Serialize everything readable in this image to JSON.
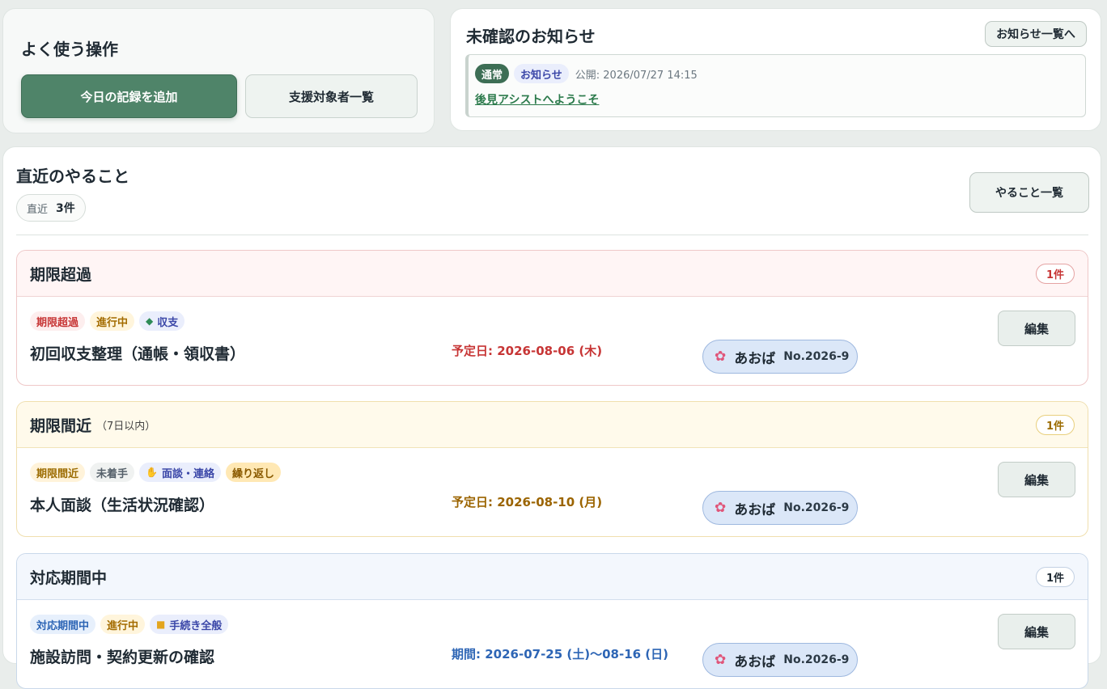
{
  "quick": {
    "title": "よく使う操作",
    "add_today": "今日の記録を追加",
    "clients": "支援対象者一覧"
  },
  "notice": {
    "title": "未確認のお知らせ",
    "all_button": "お知らせ一覧へ",
    "item": {
      "badge_type": "通常",
      "badge_kind": "お知らせ",
      "published": "公開: 2026/07/27 14:15",
      "link": "後見アシストへようこそ"
    }
  },
  "todo": {
    "title": "直近のやること",
    "count_label": "直近",
    "count_value": "3件",
    "all_button": "やること一覧",
    "groups": [
      {
        "title": "期限超過",
        "subtitle": "",
        "count": "1件",
        "task": {
          "tags": [
            "期限超過",
            "進行中",
            "収支"
          ],
          "category_icon": "money-icon",
          "title": "初回収支整理（通帳・領収書）",
          "due": "予定日: 2026-08-06 (木)",
          "person_name": "あおば",
          "person_no": "No.2026-9",
          "edit": "編集"
        }
      },
      {
        "title": "期限間近",
        "subtitle": "（7日以内）",
        "count": "1件",
        "task": {
          "tags": [
            "期限間近",
            "未着手",
            "面談・連絡",
            "繰り返し"
          ],
          "category_icon": "handshake-icon",
          "title": "本人面談（生活状況確認）",
          "due": "予定日: 2026-08-10 (月)",
          "person_name": "あおば",
          "person_no": "No.2026-9",
          "edit": "編集"
        }
      },
      {
        "title": "対応期間中",
        "subtitle": "",
        "count": "1件",
        "task": {
          "tags": [
            "対応期間中",
            "進行中",
            "手続き全般"
          ],
          "category_icon": "folder-icon",
          "title": "施設訪問・契約更新の確認",
          "due": "期間: 2026-07-25 (土)〜08-16 (日)",
          "person_name": "あおば",
          "person_no": "No.2026-9",
          "edit": "編集"
        }
      }
    ]
  }
}
